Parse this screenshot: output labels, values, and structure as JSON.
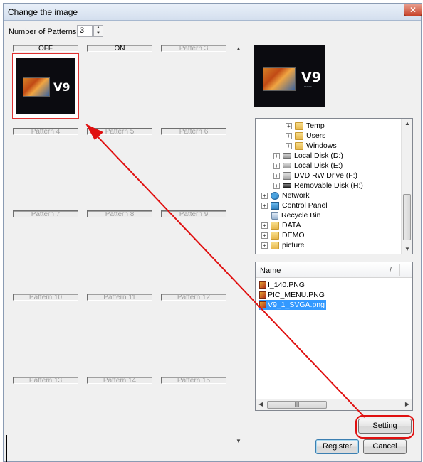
{
  "window": {
    "title": "Change the image",
    "close_icon": "close-icon"
  },
  "number_of_patterns": {
    "label": "Number of Patterns",
    "value": "3"
  },
  "patterns": [
    "OFF",
    "ON",
    "Pattern 3",
    "Pattern 4",
    "Pattern 5",
    "Pattern 6",
    "Pattern 7",
    "Pattern 8",
    "Pattern 9",
    "Pattern 10",
    "Pattern 11",
    "Pattern 12",
    "Pattern 13",
    "Pattern 14",
    "Pattern 15"
  ],
  "preview": {
    "brand_text": "V9",
    "sub_text": "SERIES"
  },
  "tree": {
    "items": [
      {
        "label": "Temp",
        "icon": "folder-icon"
      },
      {
        "label": "Users",
        "icon": "folder-icon"
      },
      {
        "label": "Windows",
        "icon": "folder-icon"
      },
      {
        "label": "Local Disk (D:)",
        "icon": "disk-icon"
      },
      {
        "label": "Local Disk (E:)",
        "icon": "disk-icon"
      },
      {
        "label": "DVD RW Drive (F:)",
        "icon": "dvd-icon"
      },
      {
        "label": "Removable Disk (H:)",
        "icon": "usb-icon"
      },
      {
        "label": "Network",
        "icon": "network-icon"
      },
      {
        "label": "Control Panel",
        "icon": "control-panel-icon"
      },
      {
        "label": "Recycle Bin",
        "icon": "recycle-bin-icon"
      },
      {
        "label": "DATA",
        "icon": "folder-icon"
      },
      {
        "label": "DEMO",
        "icon": "folder-icon"
      },
      {
        "label": "picture",
        "icon": "folder-icon"
      }
    ]
  },
  "file_list": {
    "header_name": "Name",
    "sort_glyph": "/",
    "files": [
      "I_140.PNG",
      "PIC_MENU.PNG",
      "V9_1_SVGA.png"
    ],
    "selected": "V9_1_SVGA.png",
    "scroll_grip": "III"
  },
  "buttons": {
    "setting": "Setting",
    "register": "Register",
    "cancel": "Cancel"
  },
  "colors": {
    "highlight": "#e01010",
    "selection": "#3399ff",
    "title_bar": "#d4dfee"
  }
}
